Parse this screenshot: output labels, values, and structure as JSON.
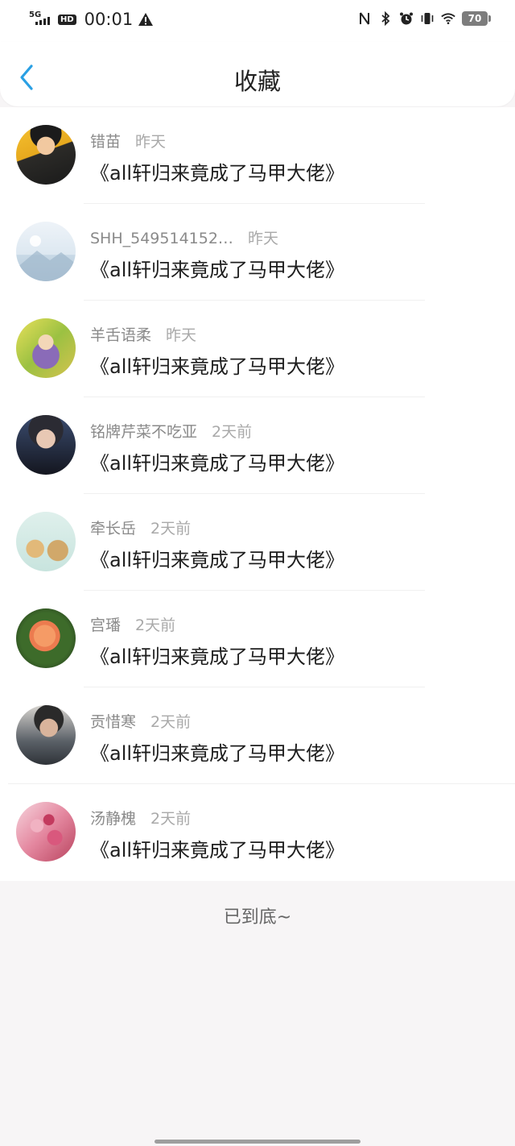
{
  "status_bar": {
    "network": "5G",
    "hd": "HD",
    "time": "00:01",
    "battery": "70"
  },
  "header": {
    "title": "收藏"
  },
  "items": [
    {
      "user": "错苗",
      "time": "昨天",
      "content": "《all轩归来竟成了马甲大佬》",
      "avatar": "child-in-leather-jacket"
    },
    {
      "user": "SHH_549514152…",
      "time": "昨天",
      "content": "《all轩归来竟成了马甲大佬》",
      "avatar": "default-landscape-avatar"
    },
    {
      "user": "羊舌语柔",
      "time": "昨天",
      "content": "《all轩归来竟成了马甲大佬》",
      "avatar": "girl-in-flowers"
    },
    {
      "user": "铭牌芹菜不吃亚",
      "time": "2天前",
      "content": "《all轩归来竟成了马甲大佬》",
      "avatar": "young-man-portrait"
    },
    {
      "user": "牵长岳",
      "time": "2天前",
      "content": "《all轩归来竟成了马甲大佬》",
      "avatar": "cartoon-cats"
    },
    {
      "user": "宫璠",
      "time": "2天前",
      "content": "《all轩归来竟成了马甲大佬》",
      "avatar": "orange-rose"
    },
    {
      "user": "贡惜寒",
      "time": "2天前",
      "content": "《all轩归来竟成了马甲大佬》",
      "avatar": "man-photo"
    },
    {
      "user": "汤静槐",
      "time": "2天前",
      "content": "《all轩归来竟成了马甲大佬》",
      "avatar": "pink-blossoms"
    }
  ],
  "footer": {
    "end_text": "已到底~"
  }
}
